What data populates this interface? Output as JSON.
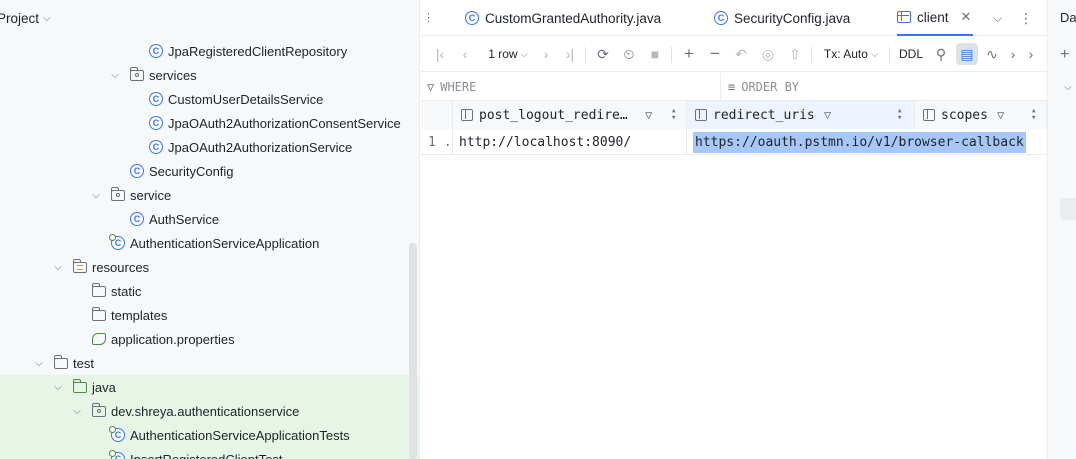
{
  "project": {
    "title": "Project",
    "tree": [
      {
        "label": "JpaRegisteredClientRepository",
        "kind": "class",
        "icon": "class-icon"
      },
      {
        "label": "services",
        "kind": "package",
        "icon": "package-folder-icon",
        "arrow": "expanded"
      },
      {
        "label": "CustomUserDetailsService",
        "kind": "class",
        "icon": "class-icon"
      },
      {
        "label": "JpaOAuth2AuthorizationConsentService",
        "kind": "class",
        "icon": "class-icon"
      },
      {
        "label": "JpaOAuth2AuthorizationService",
        "kind": "class",
        "icon": "class-icon"
      },
      {
        "label": "SecurityConfig",
        "kind": "class",
        "icon": "class-icon"
      },
      {
        "label": "service",
        "kind": "package",
        "icon": "package-folder-icon",
        "arrow": "expanded"
      },
      {
        "label": "AuthService",
        "kind": "class",
        "icon": "class-icon"
      },
      {
        "label": "AuthenticationServiceApplication",
        "kind": "runnable-class",
        "icon": "spring-class-icon"
      },
      {
        "label": "resources",
        "kind": "resources",
        "icon": "resources-folder-icon",
        "arrow": "expanded"
      },
      {
        "label": "static",
        "kind": "folder",
        "icon": "folder-icon"
      },
      {
        "label": "templates",
        "kind": "folder",
        "icon": "folder-icon"
      },
      {
        "label": "application.properties",
        "kind": "properties",
        "icon": "properties-file-icon"
      },
      {
        "label": "test",
        "kind": "folder",
        "icon": "folder-icon",
        "arrow": "expanded"
      },
      {
        "label": "java",
        "kind": "test-folder",
        "icon": "test-folder-icon",
        "arrow": "expanded"
      },
      {
        "label": "dev.shreya.authenticationservice",
        "kind": "package",
        "icon": "package-folder-icon",
        "arrow": "expanded"
      },
      {
        "label": "AuthenticationServiceApplicationTests",
        "kind": "test-class",
        "icon": "test-class-icon"
      },
      {
        "label": "InsertRegisteredClientTest",
        "kind": "test-class",
        "icon": "test-class-icon"
      }
    ]
  },
  "tabs": [
    {
      "label": "CustomGrantedAuthority.java",
      "icon": "class-icon",
      "active": false
    },
    {
      "label": "SecurityConfig.java",
      "icon": "class-icon",
      "active": false
    },
    {
      "label": "client",
      "icon": "table-icon",
      "active": true
    }
  ],
  "toolbar": {
    "rows_label": "1 row",
    "tx_label": "Tx: Auto",
    "ddl_label": "DDL"
  },
  "filter": {
    "where_placeholder": "WHERE",
    "orderby_placeholder": "ORDER BY"
  },
  "grid": {
    "columns": [
      {
        "name": "post_logout_redire…"
      },
      {
        "name": "redirect_uris"
      },
      {
        "name": "scopes"
      }
    ],
    "rows": [
      {
        "num": "1",
        "cells": [
          "http://localhost:8090/",
          "https://oauth.pstmn.io/v1/browser-callback",
          ""
        ]
      }
    ]
  },
  "right_panel": {
    "title": "Da"
  },
  "colors": {
    "accent": "#3574f0",
    "selection": "#a6c7f7",
    "test_bg": "#e6f5e6"
  }
}
